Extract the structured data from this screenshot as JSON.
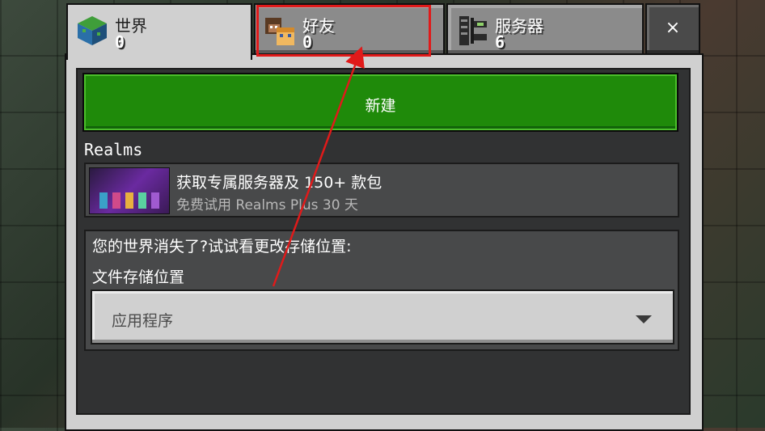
{
  "tabs": [
    {
      "id": "world",
      "label": "世界",
      "count": "0",
      "icon": "grass-block-icon"
    },
    {
      "id": "friends",
      "label": "好友",
      "count": "0",
      "icon": "friends-heads-icon"
    },
    {
      "id": "servers",
      "label": "服务器",
      "count": "6",
      "icon": "server-rack-icon"
    }
  ],
  "close_label": "×",
  "new_button_label": "新建",
  "realms": {
    "section_label": "Realms",
    "title": "获取专属服务器及 150+ 款包",
    "subtitle": "免费试用 Realms Plus 30 天"
  },
  "storage": {
    "question": "您的世界消失了?试试看更改存储位置:",
    "label": "文件存储位置",
    "selected_value": "应用程序"
  },
  "colors": {
    "highlight": "#e01a1a",
    "new_button": "#1f8a0a",
    "arrow": "#e01a1a"
  }
}
